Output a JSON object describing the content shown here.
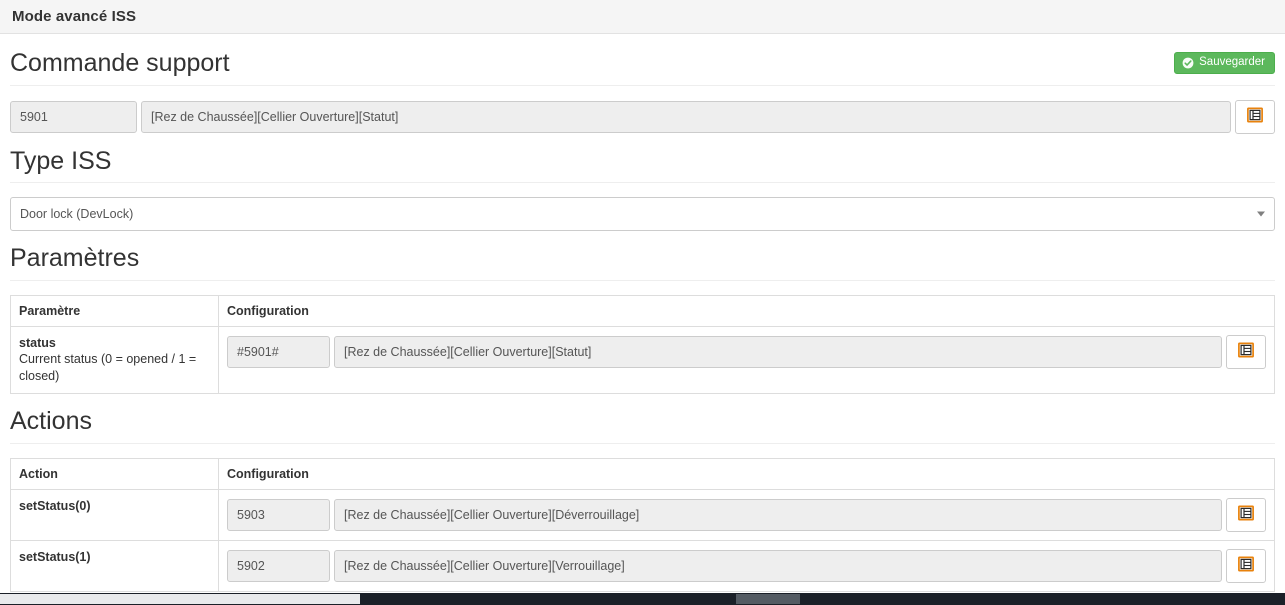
{
  "window": {
    "title": "Mode avancé ISS"
  },
  "sections": {
    "command": {
      "title": "Commande support",
      "save_label": "Sauvegarder",
      "save_icon": "check-circle-icon",
      "save_color": "#5cb85c",
      "id_value": "5901",
      "command_value": "[Rez de Chaussée][Cellier Ouverture][Statut]",
      "picker_icon": "list-table-icon"
    },
    "type": {
      "title": "Type ISS",
      "selected": "Door lock (DevLock)",
      "options": [
        "Door lock (DevLock)"
      ],
      "arrow_icon": "chevron-down-icon"
    },
    "parameters": {
      "title": "Paramètres",
      "columns": [
        "Paramètre",
        "Configuration"
      ],
      "rows": [
        {
          "name": "status",
          "description": "Current status (0 = opened / 1 = closed)",
          "id_value": "#5901#",
          "command_value": "[Rez de Chaussée][Cellier Ouverture][Statut]",
          "picker_icon": "list-table-icon"
        }
      ]
    },
    "actions": {
      "title": "Actions",
      "columns": [
        "Action",
        "Configuration"
      ],
      "rows": [
        {
          "name": "setStatus(0)",
          "id_value": "5903",
          "command_value": "[Rez de Chaussée][Cellier Ouverture][Déverrouillage]",
          "picker_icon": "list-table-icon"
        },
        {
          "name": "setStatus(1)",
          "id_value": "5902",
          "command_value": "[Rez de Chaussée][Cellier Ouverture][Verrouillage]",
          "picker_icon": "list-table-icon"
        }
      ]
    }
  },
  "scrollbar": {
    "orientation": "horizontal"
  }
}
